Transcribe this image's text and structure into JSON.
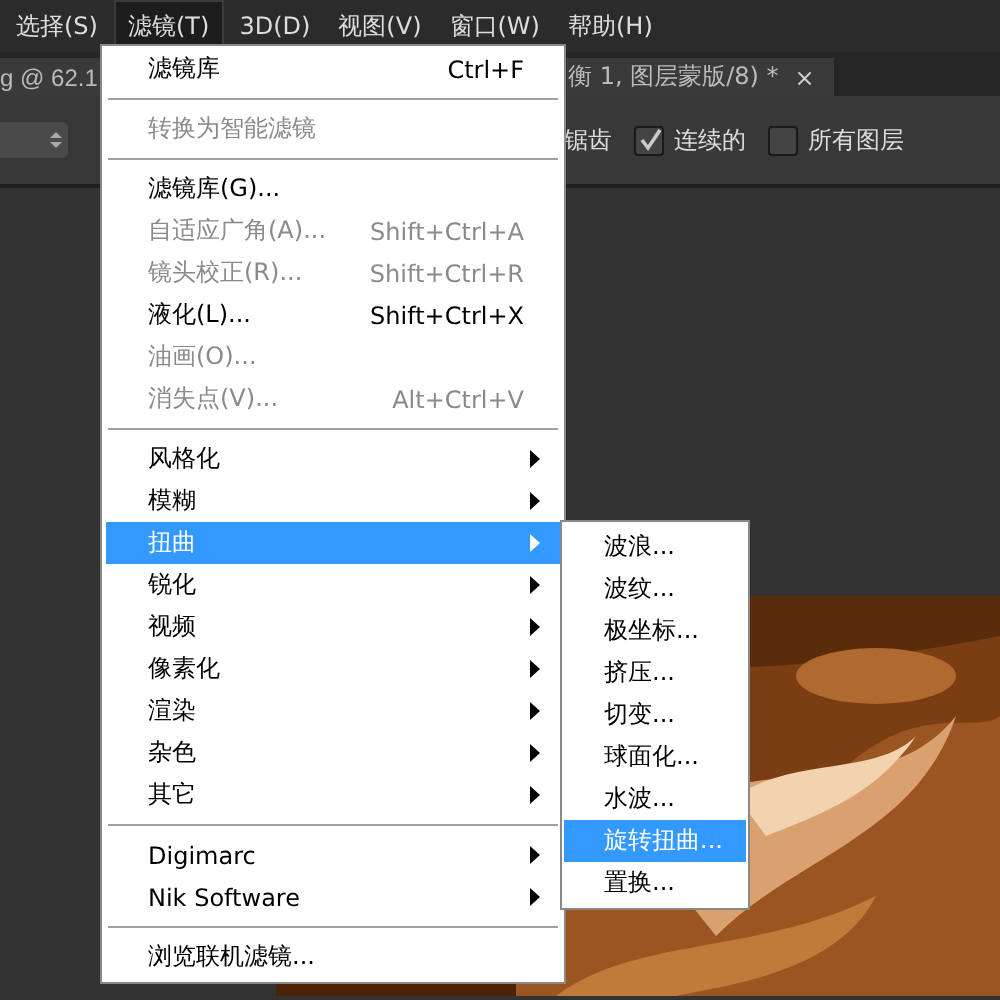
{
  "menubar": [
    {
      "label": "选择(S)",
      "selected": false
    },
    {
      "label": "滤镜(T)",
      "selected": true
    },
    {
      "label": "3D(D)",
      "selected": false
    },
    {
      "label": "视图(V)",
      "selected": false
    },
    {
      "label": "窗口(W)",
      "selected": false
    },
    {
      "label": "帮助(H)",
      "selected": false
    }
  ],
  "tabs": [
    {
      "label": "g @ 62.1"
    },
    {
      "label": "衡 1, 图层蒙版/8) *",
      "close": "×"
    }
  ],
  "options_bar": {
    "antialias_label": "锯齿",
    "contiguous": {
      "label": "连续的",
      "checked": true
    },
    "all_layers": {
      "label": "所有图层",
      "checked": false
    }
  },
  "filter_menu": [
    {
      "kind": "item",
      "label": "滤镜库",
      "shortcut": "Ctrl+F",
      "disabled": false,
      "submenu": false,
      "selected": false
    },
    {
      "kind": "separator"
    },
    {
      "kind": "item",
      "label": "转换为智能滤镜",
      "disabled": true,
      "submenu": false,
      "selected": false
    },
    {
      "kind": "separator"
    },
    {
      "kind": "item",
      "label": "滤镜库(G)...",
      "disabled": false,
      "submenu": false,
      "selected": false
    },
    {
      "kind": "item",
      "label": "自适应广角(A)...",
      "shortcut": "Shift+Ctrl+A",
      "disabled": true,
      "submenu": false,
      "selected": false
    },
    {
      "kind": "item",
      "label": "镜头校正(R)...",
      "shortcut": "Shift+Ctrl+R",
      "disabled": true,
      "submenu": false,
      "selected": false
    },
    {
      "kind": "item",
      "label": "液化(L)...",
      "shortcut": "Shift+Ctrl+X",
      "disabled": false,
      "submenu": false,
      "selected": false
    },
    {
      "kind": "item",
      "label": "油画(O)...",
      "disabled": true,
      "submenu": false,
      "selected": false
    },
    {
      "kind": "item",
      "label": "消失点(V)...",
      "shortcut": "Alt+Ctrl+V",
      "disabled": true,
      "submenu": false,
      "selected": false
    },
    {
      "kind": "separator"
    },
    {
      "kind": "item",
      "label": "风格化",
      "disabled": false,
      "submenu": true,
      "selected": false
    },
    {
      "kind": "item",
      "label": "模糊",
      "disabled": false,
      "submenu": true,
      "selected": false
    },
    {
      "kind": "item",
      "label": "扭曲",
      "disabled": false,
      "submenu": true,
      "selected": true
    },
    {
      "kind": "item",
      "label": "锐化",
      "disabled": false,
      "submenu": true,
      "selected": false
    },
    {
      "kind": "item",
      "label": "视频",
      "disabled": false,
      "submenu": true,
      "selected": false
    },
    {
      "kind": "item",
      "label": "像素化",
      "disabled": false,
      "submenu": true,
      "selected": false
    },
    {
      "kind": "item",
      "label": "渲染",
      "disabled": false,
      "submenu": true,
      "selected": false
    },
    {
      "kind": "item",
      "label": "杂色",
      "disabled": false,
      "submenu": true,
      "selected": false
    },
    {
      "kind": "item",
      "label": "其它",
      "disabled": false,
      "submenu": true,
      "selected": false
    },
    {
      "kind": "separator"
    },
    {
      "kind": "item",
      "label": "Digimarc",
      "disabled": false,
      "submenu": true,
      "selected": false
    },
    {
      "kind": "item",
      "label": "Nik Software",
      "disabled": false,
      "submenu": true,
      "selected": false
    },
    {
      "kind": "separator"
    },
    {
      "kind": "item",
      "label": "浏览联机滤镜...",
      "disabled": false,
      "submenu": false,
      "selected": false
    }
  ],
  "distort_submenu": [
    {
      "label": "波浪...",
      "selected": false
    },
    {
      "label": "波纹...",
      "selected": false
    },
    {
      "label": "极坐标...",
      "selected": false
    },
    {
      "label": "挤压...",
      "selected": false
    },
    {
      "label": "切变...",
      "selected": false
    },
    {
      "label": "球面化...",
      "selected": false
    },
    {
      "label": "水波...",
      "selected": false
    },
    {
      "label": "旋转扭曲...",
      "selected": true
    },
    {
      "label": "置换...",
      "selected": false
    }
  ]
}
